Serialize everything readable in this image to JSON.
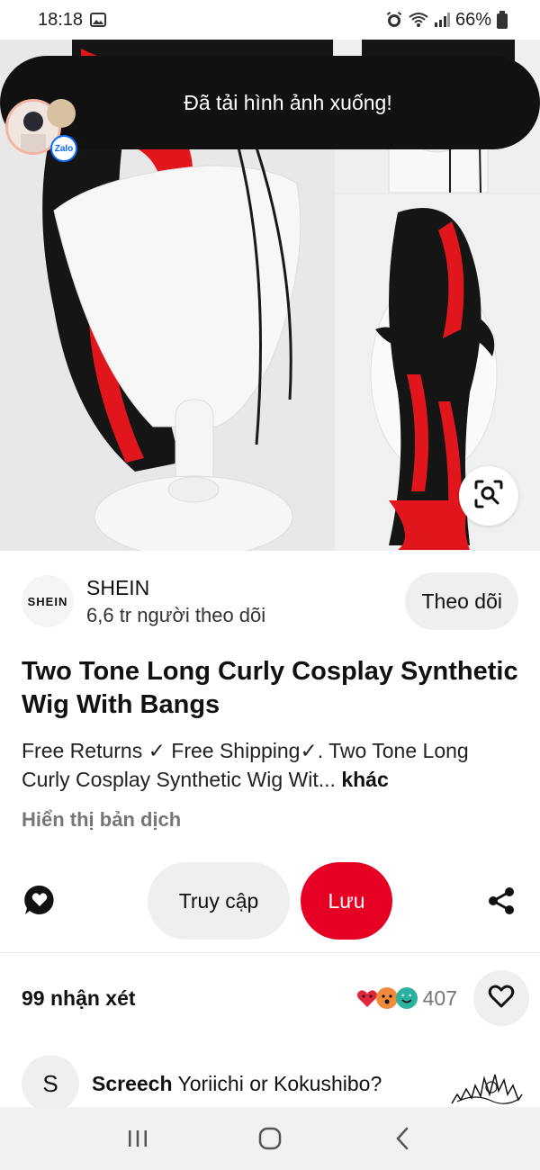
{
  "status_bar": {
    "time": "18:18",
    "battery": "66%",
    "icons": [
      "gallery-icon",
      "alarm-icon",
      "wifi-icon",
      "signal-icon",
      "battery-icon"
    ]
  },
  "toast": {
    "message": "Đã tải hình ảnh xuống!",
    "badge_label": "Zalo"
  },
  "hero": {
    "lens_icon": "visual-search-icon"
  },
  "creator": {
    "logo_text": "SHEIN",
    "name": "SHEIN",
    "followers": "6,6 tr người theo dõi",
    "follow_label": "Theo dõi"
  },
  "pin": {
    "title": "Two Tone Long Curly Cosplay Synthetic Wig With Bangs",
    "description": "Free Returns ✓ Free Shipping✓. Two Tone Long Curly Cosplay Synthetic Wig Wit...",
    "more_label": "khác",
    "translate_label": "Hiển thị bản dịch"
  },
  "actions": {
    "visit_label": "Truy cập",
    "save_label": "Lưu",
    "comment_icon": "comment-icon",
    "share_icon": "share-icon"
  },
  "comments": {
    "count_label": "99 nhận xét",
    "reaction_count": "407",
    "reactions": [
      "heart",
      "wow",
      "star-eyes"
    ],
    "items": [
      {
        "avatar_letter": "S",
        "author": "Screech",
        "text": "Yoriichi or Kokushibo?"
      }
    ]
  },
  "colors": {
    "accent_red": "#e60023",
    "button_gray": "#efefef",
    "toast_bg": "#111111",
    "muted_text": "#767676",
    "hair_red": "#e0161c",
    "hair_black": "#151515"
  }
}
